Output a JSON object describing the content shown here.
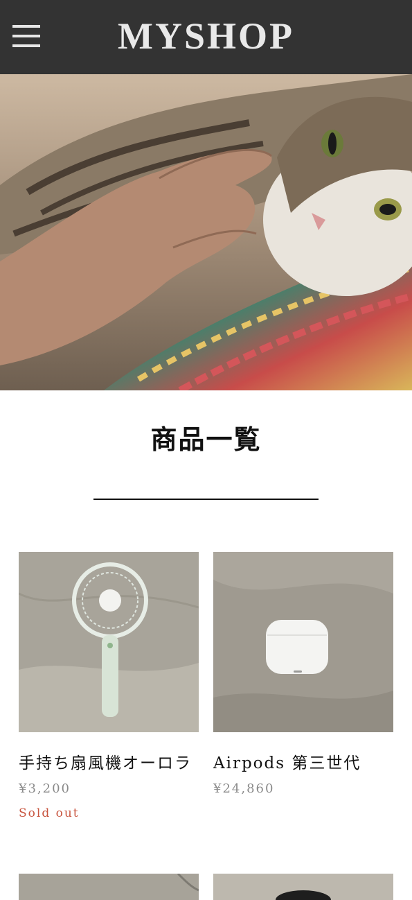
{
  "header": {
    "logo": "MYSHOP",
    "menu_icon": "hamburger-menu-icon",
    "background": "#333333"
  },
  "hero": {
    "image": "hero-cat-photo"
  },
  "section": {
    "title": "商品一覧"
  },
  "products": [
    {
      "name": "手持ち扇風機オーロラ",
      "price": "¥3,200",
      "status": "Sold out",
      "image": "handheld-fan-photo"
    },
    {
      "name": "Airpods 第三世代",
      "price": "¥24,860",
      "status": "",
      "image": "airpods-case-photo"
    }
  ],
  "colors": {
    "soldout": "#c8553f",
    "price": "#8a8a8a"
  }
}
